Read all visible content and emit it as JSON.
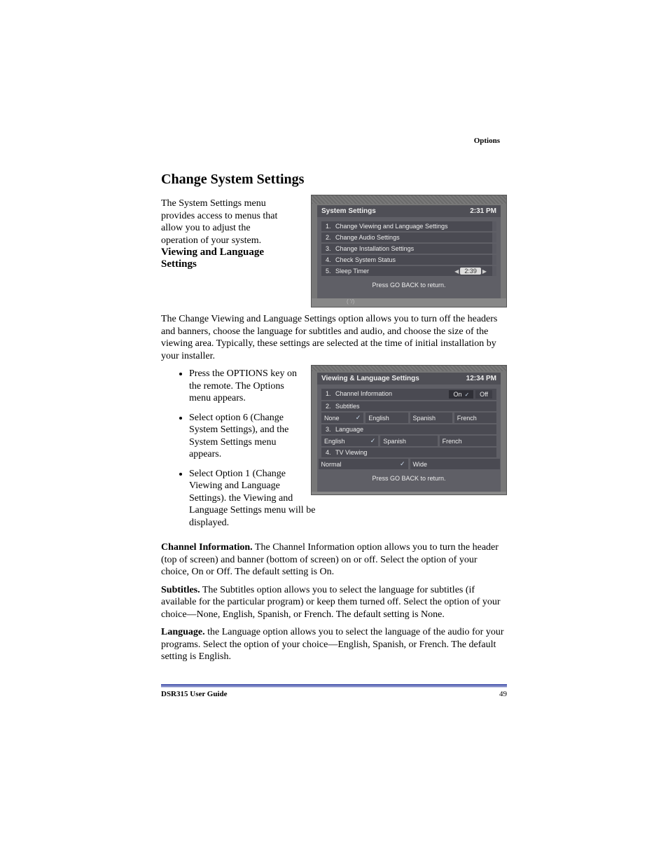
{
  "header_label": "Options",
  "main_heading": "Change System Settings",
  "intro_paragraph": "The System Settings menu provides access to menus that allow you to adjust the operation of your system.",
  "screenshot1": {
    "title": "System Settings",
    "time": "2:31 PM",
    "items": [
      {
        "num": "1.",
        "label": "Change Viewing and Language Settings"
      },
      {
        "num": "2.",
        "label": "Change Audio Settings"
      },
      {
        "num": "3.",
        "label": "Change Installation Settings"
      },
      {
        "num": "4.",
        "label": "Check System Status"
      }
    ],
    "sleep": {
      "num": "5.",
      "label": "Sleep Timer",
      "value": "2:39"
    },
    "footer": "Press GO BACK to return."
  },
  "sub_heading": "Viewing and Language Settings",
  "viewing_paragraph": "The Change Viewing and Language Settings option allows you to turn off the headers and banners, choose the language for subtitles and audio, and choose the size of the viewing area. Typically, these settings are selected at the time of initial installation by your installer.",
  "instructions": [
    "Press the OPTIONS key on the remote. The Options menu appears.",
    "Select option 6 (Change System Settings), and the System Settings menu appears.",
    "Select Option 1 (Change Viewing and Language Settings). the Viewing and Language Settings menu will be displayed."
  ],
  "screenshot2": {
    "title": "Viewing & Language Settings",
    "time": "12:34 PM",
    "row1": {
      "num": "1.",
      "label": "Channel Information",
      "options": [
        "On",
        "Off"
      ],
      "selected": "On"
    },
    "row2": {
      "num": "2.",
      "label": "Subtitles",
      "options": [
        "None",
        "English",
        "Spanish",
        "French"
      ],
      "selected": "None"
    },
    "row3": {
      "num": "3.",
      "label": "Language",
      "options": [
        "English",
        "Spanish",
        "French"
      ],
      "selected": "English"
    },
    "row4": {
      "num": "4.",
      "label": "TV Viewing",
      "options": [
        "Normal",
        "Wide"
      ],
      "selected": "Normal"
    },
    "footer": "Press GO BACK to return."
  },
  "paras": [
    {
      "lead": "Channel Information.",
      "body": " The Channel Information option allows you to turn the header (top of screen) and banner (bottom of screen) on or off. Select the option of your choice, On or Off. The default setting is On."
    },
    {
      "lead": "Subtitles.",
      "body": " The Subtitles option allows you to select the language for subtitles (if available for the particular program) or keep them turned off. Select the option of your choice—None, English, Spanish, or French. The default setting is None."
    },
    {
      "lead": "Language.",
      "body": " the Language option allows you to select the language of the audio for your programs. Select the option of your choice—English, Spanish, or French. The default setting is English."
    }
  ],
  "footer": {
    "left": "DSR315 User Guide",
    "right": "49"
  }
}
